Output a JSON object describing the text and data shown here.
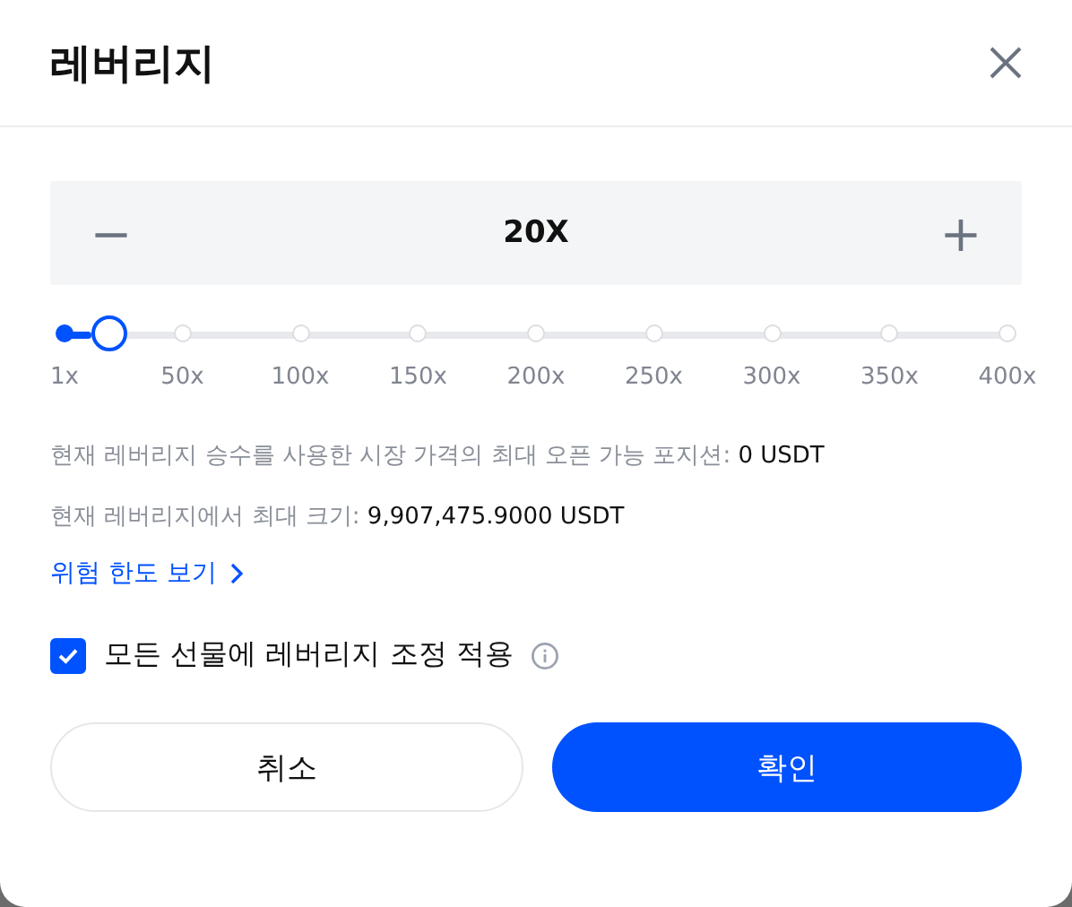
{
  "dialog": {
    "title": "레버리지"
  },
  "stepper": {
    "minus": "−",
    "value": "20X",
    "plus": "+"
  },
  "slider": {
    "level": 0.0476,
    "ticks": [
      "1x",
      "50x",
      "100x",
      "150x",
      "200x",
      "250x",
      "300x",
      "350x",
      "400x"
    ]
  },
  "info": [
    {
      "label": "현재 레버리지 승수를 사용한 시장 가격의 최대 오픈 가능 포지션: ",
      "value": "0 USDT"
    },
    {
      "label": "현재 레버리지에서 최대 크기: ",
      "value": "9,907,475.9000 USDT"
    }
  ],
  "risk_link": "위험 한도 보기",
  "apply_all": {
    "label": "모든 선물에 레버리지 조정 적용",
    "checked": true
  },
  "buttons": {
    "cancel": "취소",
    "confirm": "확인"
  }
}
